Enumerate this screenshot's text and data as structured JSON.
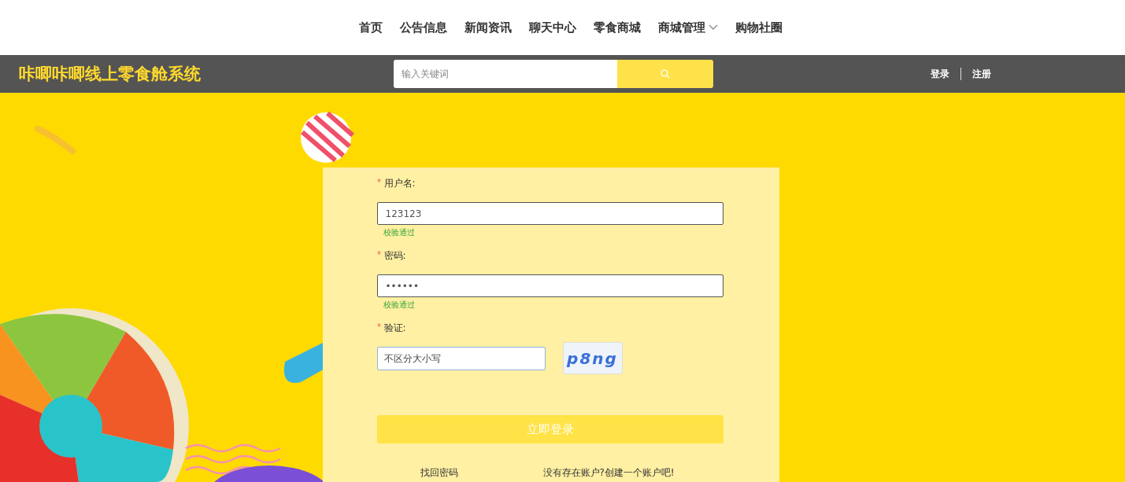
{
  "nav": {
    "items": [
      {
        "label": "首页",
        "dropdown": false
      },
      {
        "label": "公告信息",
        "dropdown": false
      },
      {
        "label": "新闻资讯",
        "dropdown": false
      },
      {
        "label": "聊天中心",
        "dropdown": false
      },
      {
        "label": "零食商城",
        "dropdown": false
      },
      {
        "label": "商城管理",
        "dropdown": true
      },
      {
        "label": "购物社圈",
        "dropdown": false
      }
    ]
  },
  "header": {
    "title": "咔唧咔唧线上零食舱系统",
    "search": {
      "placeholder": "输入关键词"
    },
    "links": [
      "登录",
      "注册"
    ]
  },
  "form": {
    "fields": [
      {
        "kind": "text",
        "label": "用户名:",
        "required": true,
        "value": "123123",
        "hint": "校验通过"
      },
      {
        "kind": "password",
        "label": "密码:",
        "required": true,
        "value": "••••••",
        "hint": "校验通过"
      },
      {
        "kind": "captcha",
        "label": "验证:",
        "required": true,
        "placeholder": "不区分大小写",
        "captcha": "p8ng"
      }
    ],
    "submit": "立即登录",
    "links": [
      "找回密码",
      "没有存在账户?创建一个账户吧!"
    ]
  }
}
